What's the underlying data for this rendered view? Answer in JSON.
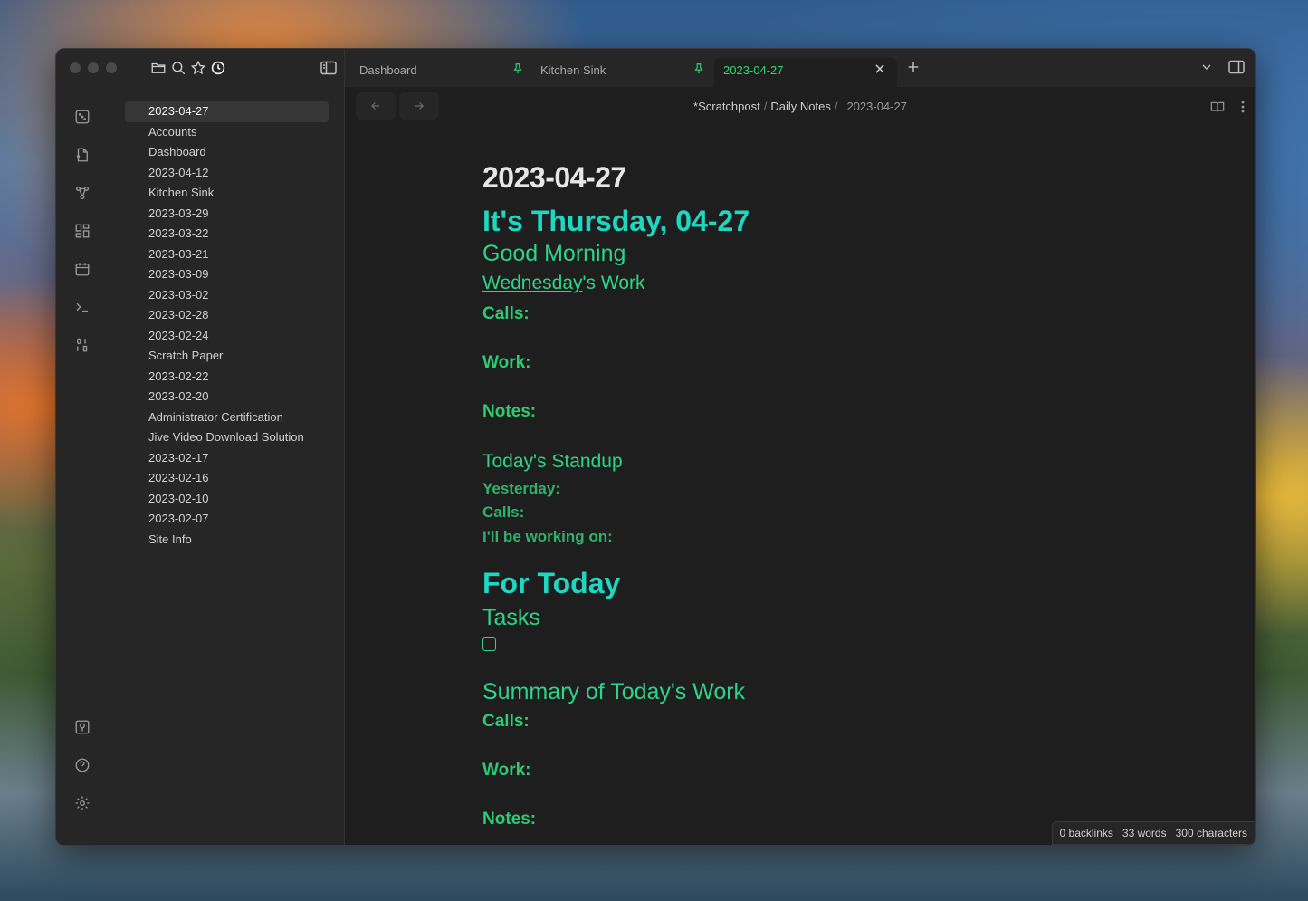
{
  "explorer_icons": [
    "folder-icon",
    "search-icon",
    "star-icon",
    "clock-icon"
  ],
  "tabs": [
    {
      "label": "Dashboard",
      "pinned": true,
      "active": false
    },
    {
      "label": "Kitchen Sink",
      "pinned": true,
      "active": false
    },
    {
      "label": "2023-04-27",
      "pinned": false,
      "active": true
    }
  ],
  "files": [
    "2023-04-27",
    "Accounts",
    "Dashboard",
    "2023-04-12",
    "Kitchen Sink",
    "2023-03-29",
    "2023-03-22",
    "2023-03-21",
    "2023-03-09",
    "2023-03-02",
    "2023-02-28",
    "2023-02-24",
    "Scratch Paper",
    "2023-02-22",
    "2023-02-20",
    "Administrator Certification",
    "Jive Video Download Solution",
    "2023-02-17",
    "2023-02-16",
    "2023-02-10",
    "2023-02-07",
    "Site Info"
  ],
  "breadcrumb": {
    "vault": "*Scratchpost",
    "separator": "/",
    "folder": "Daily Notes",
    "current": "2023-04-27"
  },
  "note": {
    "title": "2023-04-27",
    "heading_day": "It's Thursday, 04-27",
    "good_morning": "Good Morning",
    "prev_link": "Wednesday",
    "prev_suffix": "'s Work",
    "calls": "Calls:",
    "work": "Work:",
    "notes": "Notes:",
    "standup": "Today's Standup",
    "yesterday": "Yesterday:",
    "standup_calls": "Calls:",
    "working_on": "I'll be working on:",
    "for_today": "For Today",
    "tasks": "Tasks",
    "summary": "Summary of Today's Work",
    "summary_calls": "Calls:",
    "summary_work": "Work:",
    "summary_notes": "Notes:"
  },
  "status": {
    "backlinks": "0 backlinks",
    "words": "33 words",
    "characters": "300 characters"
  },
  "colors": {
    "accent": "#2ed573",
    "heading_teal": "#1fd6c1",
    "heading_green": "#2fd38a"
  }
}
